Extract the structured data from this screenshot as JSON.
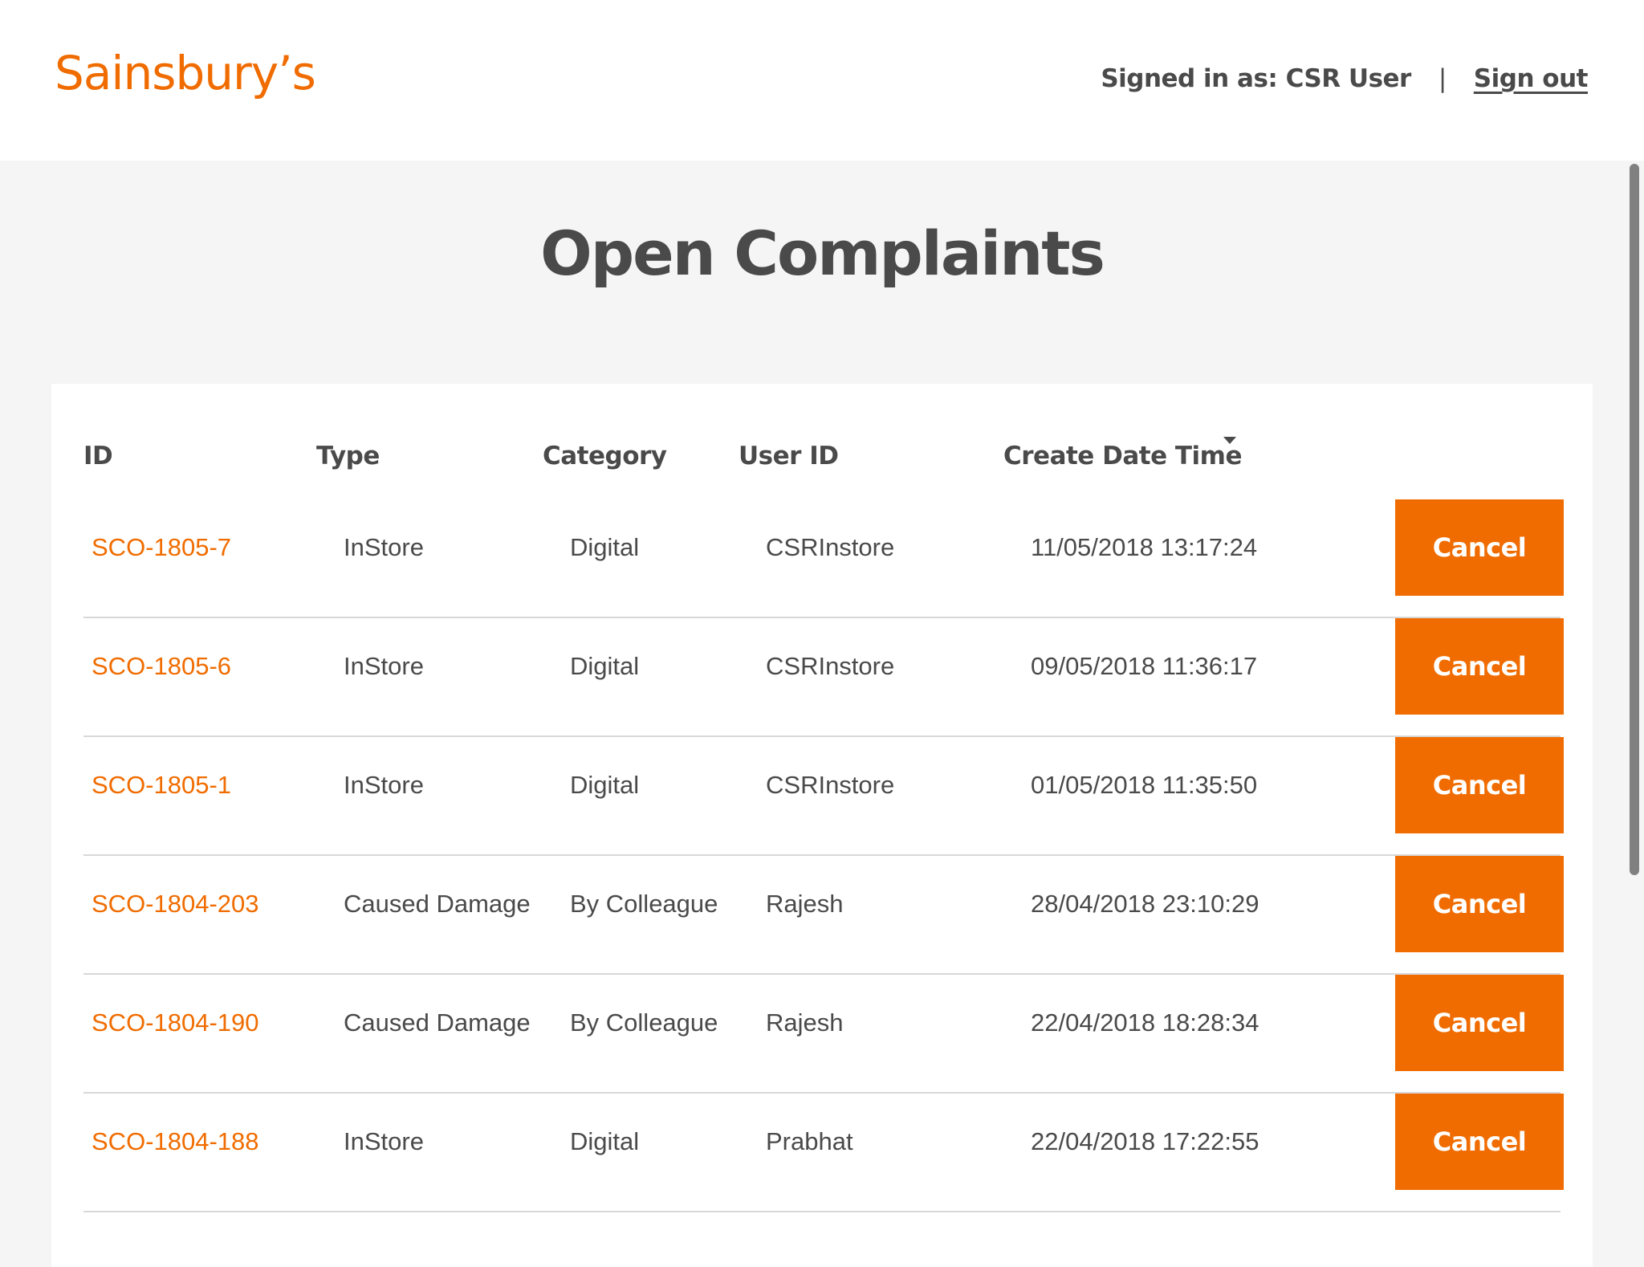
{
  "brand": {
    "logo_text": "Sainsbury’s",
    "accent_color": "#f06c00"
  },
  "header": {
    "signed_in_text": "Signed in as: CSR User",
    "divider": "|",
    "sign_out_label": "Sign out"
  },
  "page": {
    "title": "Open Complaints"
  },
  "table": {
    "columns": [
      "ID",
      "Type",
      "Category",
      "User ID",
      "Create Date Time"
    ],
    "sorted_column": "Create Date Time",
    "sort_direction": "descending",
    "rows": [
      {
        "id": "SCO-1805-7",
        "type": "InStore",
        "category": "Digital",
        "user_id": "CSRInstore",
        "created": "11/05/2018 13:17:24",
        "action": "Cancel"
      },
      {
        "id": "SCO-1805-6",
        "type": "InStore",
        "category": "Digital",
        "user_id": "CSRInstore",
        "created": "09/05/2018 11:36:17",
        "action": "Cancel"
      },
      {
        "id": "SCO-1805-1",
        "type": "InStore",
        "category": "Digital",
        "user_id": "CSRInstore",
        "created": "01/05/2018 11:35:50",
        "action": "Cancel"
      },
      {
        "id": "SCO-1804-203",
        "type": "Caused Damage",
        "category": "By Colleague",
        "user_id": "Rajesh",
        "created": "28/04/2018 23:10:29",
        "action": "Cancel"
      },
      {
        "id": "SCO-1804-190",
        "type": "Caused Damage",
        "category": "By Colleague",
        "user_id": "Rajesh",
        "created": "22/04/2018 18:28:34",
        "action": "Cancel"
      },
      {
        "id": "SCO-1804-188",
        "type": "InStore",
        "category": "Digital",
        "user_id": "Prabhat",
        "created": "22/04/2018 17:22:55",
        "action": "Cancel"
      }
    ]
  }
}
